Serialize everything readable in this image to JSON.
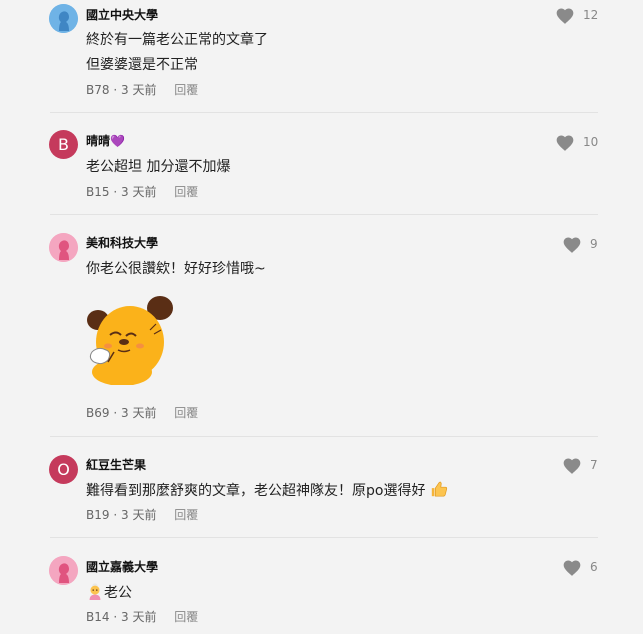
{
  "comments": [
    {
      "author": "國立中央大學",
      "avatar": {
        "type": "person",
        "bg": "#6fb3e6",
        "fg": "#4a90c9"
      },
      "lines": [
        "終於有一篇老公正常的文章了",
        "但婆婆還是不正常"
      ],
      "floor": "B78",
      "time": "3 天前",
      "reply": "回覆",
      "likes": "12"
    },
    {
      "author": "晴晴💜",
      "avatar": {
        "type": "letter",
        "letter": "B",
        "bg": "#c53a5c"
      },
      "lines": [
        "老公超坦 加分還不加爆"
      ],
      "floor": "B15",
      "time": "3 天前",
      "reply": "回覆",
      "likes": "10"
    },
    {
      "author": "美和科技大學",
      "avatar": {
        "type": "person",
        "bg": "#f4a6c0",
        "fg": "#e0547f"
      },
      "lines": [
        "你老公很讚欸！好好珍惜哦~"
      ],
      "sticker": "yellow-dog-sticker",
      "floor": "B69",
      "time": "3 天前",
      "reply": "回覆",
      "likes": "9"
    },
    {
      "author": "紅豆生芒果",
      "avatar": {
        "type": "letter",
        "letter": "O",
        "bg": "#c53a5c"
      },
      "lines": [
        "難得看到那麼舒爽的文章，老公超神隊友！原po選得好"
      ],
      "trailing_emoji": "thumbs-up-icon",
      "floor": "B19",
      "time": "3 天前",
      "reply": "回覆",
      "likes": "7"
    },
    {
      "author": "國立嘉義大學",
      "avatar": {
        "type": "person",
        "bg": "#f4a6c0",
        "fg": "#e0547f"
      },
      "lines": [
        "老公"
      ],
      "leading_emoji": "old-woman-icon",
      "floor": "B14",
      "time": "3 天前",
      "reply": "回覆",
      "likes": "6"
    }
  ],
  "meta_separator": "·",
  "colors": {
    "heart": "#8a8a8a",
    "divider": "#e2e2e2",
    "background": "#f3f3f3"
  }
}
